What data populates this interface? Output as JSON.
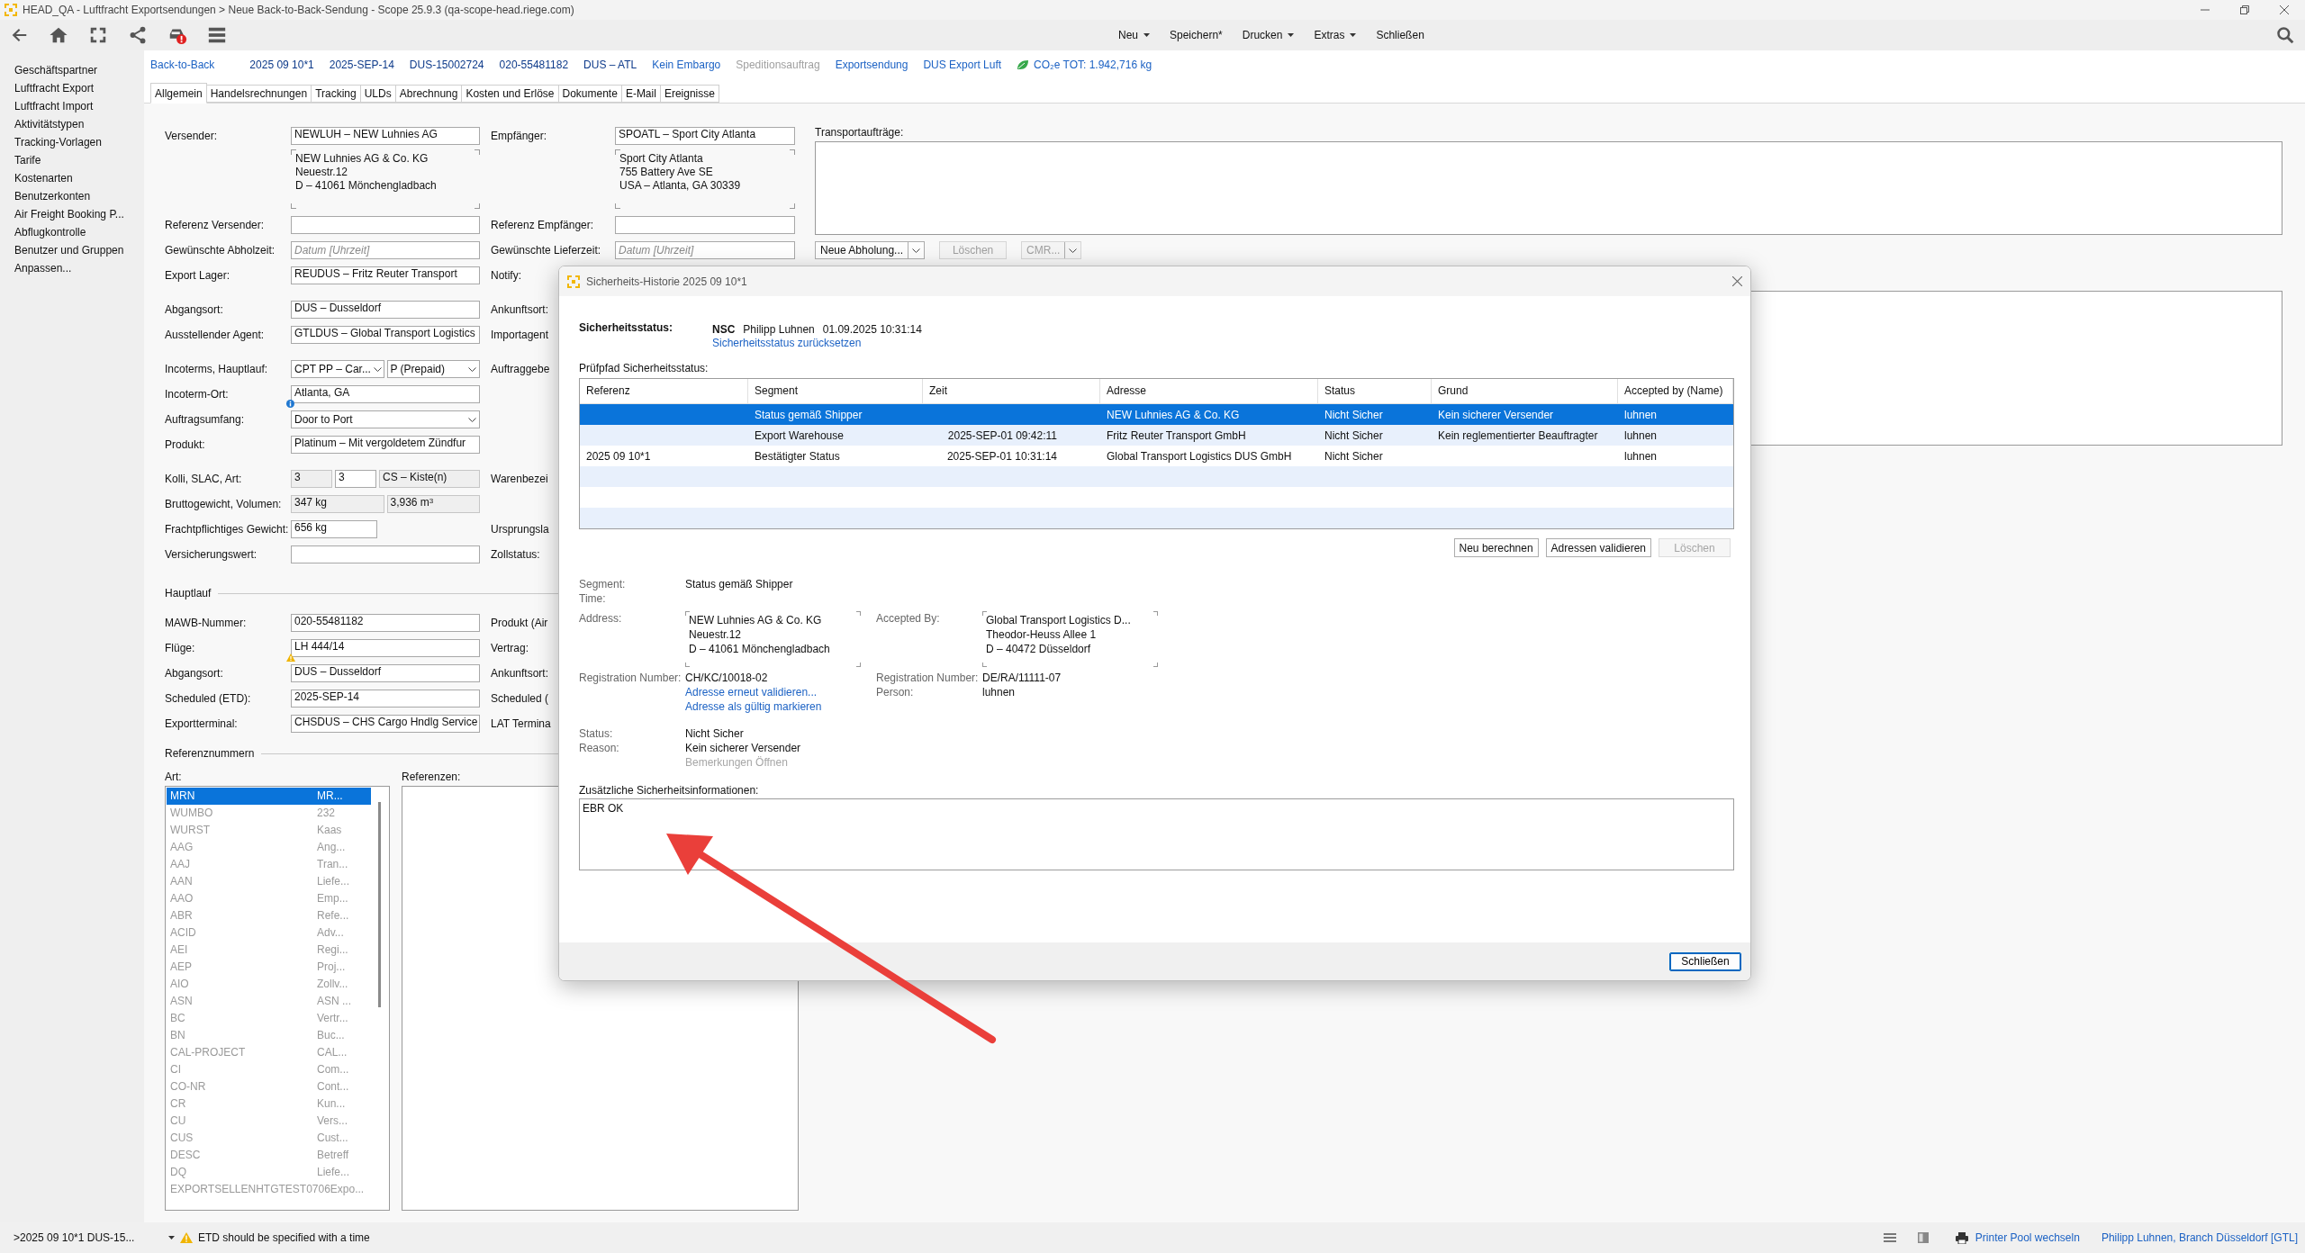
{
  "window": {
    "title": "HEAD_QA - Luftfracht Exportsendungen > Neue Back-to-Back-Sendung - Scope 25.9.3 (qa-scope-head.riege.com)"
  },
  "menu": [
    {
      "label": "Neu",
      "has_menu": true
    },
    {
      "label": "Speichern*",
      "has_menu": false
    },
    {
      "label": "Drucken",
      "has_menu": true
    },
    {
      "label": "Extras",
      "has_menu": true
    },
    {
      "label": "Schließen",
      "has_menu": false
    }
  ],
  "sidebar": {
    "items": [
      "Geschäftspartner",
      "Luftfracht Export",
      "Luftfracht Import",
      "Aktivitätstypen",
      "Tracking-Vorlagen",
      "Tarife",
      "Kostenarten",
      "Benutzerkonten",
      "Air Freight Booking P...",
      "Abflugkontrolle",
      "Benutzer und Gruppen",
      "Anpassen..."
    ]
  },
  "header": [
    {
      "text": "Back-to-Back",
      "kind": "link"
    },
    {
      "text": "2025 09 10*1",
      "kind": "info"
    },
    {
      "text": "2025-SEP-14",
      "kind": "info"
    },
    {
      "text": "DUS-15002724",
      "kind": "info"
    },
    {
      "text": "020-55481182",
      "kind": "info"
    },
    {
      "text": "DUS – ATL",
      "kind": "info"
    },
    {
      "text": "Kein Embargo",
      "kind": "link"
    },
    {
      "text": "Speditionsauftrag",
      "kind": "muted"
    },
    {
      "text": "Exportsendung",
      "kind": "link"
    },
    {
      "text": "DUS Export Luft",
      "kind": "link"
    },
    {
      "text": "CO₂e TOT: 1.942,716 kg",
      "kind": "co2"
    }
  ],
  "tabs": [
    {
      "label": "Allgemein",
      "selected": true
    },
    {
      "label": "Handelsrechnungen",
      "selected": false
    },
    {
      "label": "Tracking",
      "selected": false
    },
    {
      "label": "ULDs",
      "selected": false
    },
    {
      "label": "Abrechnung",
      "selected": false
    },
    {
      "label": "Kosten und Erlöse",
      "selected": false
    },
    {
      "label": "Dokumente",
      "selected": false
    },
    {
      "label": "E-Mail",
      "selected": false
    },
    {
      "label": "Ereignisse",
      "selected": false
    }
  ],
  "form": {
    "blocks": [
      {
        "rows": [
          {
            "left": {
              "label": "Versender:",
              "fields": [
                {
                  "kind": "text",
                  "value": "NEWLUH – NEW Luhnies AG"
                }
              ]
            },
            "right": {
              "label": "Empfänger:",
              "fields": [
                {
                  "kind": "text",
                  "value": "SPOATL – Sport City Atlanta"
                }
              ]
            }
          },
          {
            "left": {
              "fields": [
                {
                  "kind": "address",
                  "lines": [
                    "NEW Luhnies AG & Co. KG",
                    "Neuestr.12",
                    "D – 41061 Mönchengladbach"
                  ]
                }
              ]
            },
            "right": {
              "fields": [
                {
                  "kind": "address",
                  "lines": [
                    "Sport City Atlanta",
                    "755 Battery Ave SE",
                    "USA – Atlanta, GA 30339"
                  ]
                }
              ]
            }
          },
          {
            "left": {
              "label": "Referenz Versender:",
              "fields": [
                {
                  "kind": "text"
                }
              ]
            },
            "right": {
              "label": "Referenz Empfänger:",
              "fields": [
                {
                  "kind": "text"
                }
              ]
            }
          },
          {
            "left": {
              "label": "Gewünschte Abholzeit:",
              "fields": [
                {
                  "kind": "placeholder",
                  "placeholder": "Datum [Uhrzeit]"
                }
              ]
            },
            "right": {
              "label": "Gewünschte Lieferzeit:",
              "fields": [
                {
                  "kind": "placeholder",
                  "placeholder": "Datum [Uhrzeit]"
                }
              ]
            }
          },
          {
            "left": {
              "label": "Export Lager:",
              "fields": [
                {
                  "kind": "text",
                  "value": "REUDUS – Fritz Reuter Transport"
                }
              ]
            },
            "right": {
              "label": "Notify:"
            }
          }
        ]
      },
      {
        "rows": [
          {
            "left": {
              "label": "Abgangsort:",
              "fields": [
                {
                  "kind": "text",
                  "value": "DUS – Dusseldorf"
                }
              ]
            },
            "right": {
              "label": "Ankunftsort:"
            }
          },
          {
            "left": {
              "label": "Ausstellender Agent:",
              "fields": [
                {
                  "kind": "text",
                  "value": "GTLDUS – Global Transport Logistics"
                }
              ]
            },
            "right": {
              "label": "Importagent"
            }
          }
        ]
      },
      {
        "rows": [
          {
            "left": {
              "label": "Incoterms, Hauptlauf:",
              "fields": [
                {
                  "kind": "select",
                  "value": "CPT PP – Car..."
                },
                {
                  "kind": "select",
                  "value": "P (Prepaid)"
                }
              ]
            },
            "right": {
              "label": "Auftraggebe"
            }
          },
          {
            "left": {
              "label": "Incoterm-Ort:",
              "fields": [
                {
                  "kind": "text",
                  "value": "Atlanta, GA",
                  "has_info": true
                }
              ]
            }
          },
          {
            "left": {
              "label": "Auftragsumfang:",
              "fields": [
                {
                  "kind": "select",
                  "value": "Door to Port"
                }
              ]
            }
          },
          {
            "left": {
              "label": "Produkt:",
              "fields": [
                {
                  "kind": "text",
                  "value": "Platinum – Mit vergoldetem Zündfur"
                }
              ]
            }
          }
        ]
      },
      {
        "rows": [
          {
            "left": {
              "label": "Kolli, SLAC, Art:",
              "fields": [
                {
                  "kind": "locked",
                  "value": "3"
                },
                {
                  "kind": "text",
                  "value": "3"
                },
                {
                  "kind": "locked",
                  "value": "CS – Kiste(n)"
                }
              ]
            },
            "right": {
              "label": "Warenbezei"
            }
          },
          {
            "left": {
              "label": "Bruttogewicht, Volumen:",
              "fields": [
                {
                  "kind": "locked",
                  "value": "347 kg"
                },
                {
                  "kind": "locked",
                  "value": "3,936 m$^{3}$"
                }
              ]
            }
          },
          {
            "left": {
              "label": "Frachtpflichtiges Gewicht:",
              "fields": [
                {
                  "kind": "number",
                  "value": "656 kg"
                }
              ]
            },
            "right": {
              "label": "Ursprungsla"
            }
          },
          {
            "left": {
              "label": "Versicherungswert:",
              "fields": [
                {
                  "kind": "text"
                }
              ]
            },
            "right": {
              "label": "Zollstatus:"
            }
          }
        ]
      },
      {
        "section": "Hauptlauf",
        "rows": [
          {
            "left": {
              "label": "MAWB-Nummer:",
              "fields": [
                {
                  "kind": "text",
                  "value": "020-55481182"
                }
              ]
            },
            "right": {
              "label": "Produkt (Air"
            }
          },
          {
            "left": {
              "label": "Flüge:",
              "fields": [
                {
                  "kind": "text",
                  "value": "LH 444/14",
                  "has_warning": true
                }
              ]
            },
            "right": {
              "label": "Vertrag:"
            }
          },
          {
            "left": {
              "label": "Abgangsort:",
              "fields": [
                {
                  "kind": "text",
                  "value": "DUS – Dusseldorf"
                }
              ]
            },
            "right": {
              "label": "Ankunftsort:"
            }
          },
          {
            "left": {
              "label": "Scheduled (ETD):",
              "fields": [
                {
                  "kind": "text",
                  "value": "2025-SEP-14"
                }
              ]
            },
            "right": {
              "label": "Scheduled ("
            }
          },
          {
            "left": {
              "label": "Exportterminal:",
              "fields": [
                {
                  "kind": "text",
                  "value": "CHSDUS – CHS Cargo Hndlg Service"
                }
              ]
            },
            "right": {
              "label": "LAT Termina"
            }
          }
        ]
      }
    ]
  },
  "transport": {
    "label": "Transportaufträge:",
    "buttons": [
      {
        "label": "Neue Abholung...",
        "kind": "split",
        "disabled": false
      },
      {
        "label": "Löschen",
        "kind": "plain",
        "disabled": true
      },
      {
        "label": "CMR...",
        "kind": "split",
        "disabled": true
      }
    ]
  },
  "references": {
    "section": "Referenznummern",
    "types_label": "Art:",
    "refs_label": "Referenzen:",
    "types": [
      {
        "code": "MRN",
        "name": "MR...",
        "selected": true
      },
      {
        "code": "WUMBO",
        "name": "232",
        "selected": false
      },
      {
        "code": "WURST",
        "name": "Kaas",
        "selected": false
      },
      {
        "code": "AAG",
        "name": "Ang...",
        "selected": false
      },
      {
        "code": "AAJ",
        "name": "Tran...",
        "selected": false
      },
      {
        "code": "AAN",
        "name": "Liefe...",
        "selected": false
      },
      {
        "code": "AAO",
        "name": "Emp...",
        "selected": false
      },
      {
        "code": "ABR",
        "name": "Refe...",
        "selected": false
      },
      {
        "code": "ACID",
        "name": "Adv...",
        "selected": false
      },
      {
        "code": "AEI",
        "name": "Regi...",
        "selected": false
      },
      {
        "code": "AEP",
        "name": "Proj...",
        "selected": false
      },
      {
        "code": "AIO",
        "name": "Zollv...",
        "selected": false
      },
      {
        "code": "ASN",
        "name": "ASN ...",
        "selected": false
      },
      {
        "code": "BC",
        "name": "Vertr...",
        "selected": false
      },
      {
        "code": "BN",
        "name": "Buc...",
        "selected": false
      },
      {
        "code": "CAL-PROJECT",
        "name": "CAL...",
        "selected": false
      },
      {
        "code": "CI",
        "name": "Com...",
        "selected": false
      },
      {
        "code": "CO-NR",
        "name": "Cont...",
        "selected": false
      },
      {
        "code": "CR",
        "name": "Kun...",
        "selected": false
      },
      {
        "code": "CU",
        "name": "Vers...",
        "selected": false
      },
      {
        "code": "CUS",
        "name": "Cust...",
        "selected": false
      },
      {
        "code": "DESC",
        "name": "Betreff",
        "selected": false
      },
      {
        "code": "DQ",
        "name": "Liefe...",
        "selected": false
      },
      {
        "code": "EXPORTSELLENHTGTEST0706",
        "name": "Expo...",
        "selected": false
      }
    ]
  },
  "dialog": {
    "title": "Sicherheits-Historie 2025 09 10*1",
    "status_label": "Sicherheitsstatus:",
    "status_code": "NSC",
    "status_user": "Philipp Luhnen",
    "status_time": "01.09.2025 10:31:14",
    "reset_link": "Sicherheitsstatus zurücksetzen",
    "audit_label": "Prüfpfad Sicherheitsstatus:",
    "table": {
      "columns": [
        "Referenz",
        "Segment",
        "Zeit",
        "Adresse",
        "Status",
        "Grund",
        "Accepted by (Name)"
      ],
      "rows": [
        {
          "segment": "Status gemäß Shipper",
          "address": "NEW Luhnies AG & Co. KG",
          "status": "Nicht Sicher",
          "reason": "Kein sicherer Versender",
          "accepted_by": "luhnen",
          "selected": true
        },
        {
          "segment": "Export Warehouse",
          "time": "2025-SEP-01 09:42:11",
          "address": "Fritz Reuter Transport GmbH",
          "status": "Nicht Sicher",
          "reason": "Kein reglementierter Beauftragter",
          "accepted_by": "luhnen",
          "selected": false
        },
        {
          "reference": "2025 09 10*1",
          "segment": "Bestätigter Status",
          "time": "2025-SEP-01 10:31:14",
          "address": "Global Transport Logistics DUS GmbH",
          "status": "Nicht Sicher",
          "accepted_by": "luhnen",
          "selected": false
        }
      ]
    },
    "buttons": [
      {
        "label": "Neu berechnen",
        "disabled": false
      },
      {
        "label": "Adressen validieren",
        "disabled": false
      },
      {
        "label": "Löschen",
        "disabled": true
      }
    ],
    "details": {
      "segment": {
        "label": "Segment:",
        "value": "Status gemäß Shipper"
      },
      "time": {
        "label": "Time:"
      },
      "address": {
        "label": "Address:",
        "lines": [
          "NEW Luhnies AG & Co. KG",
          "Neuestr.12",
          "D – 41061 Mönchengladbach"
        ]
      },
      "registration": {
        "label": "Registration Number:",
        "value": "CH/KC/10018-02"
      },
      "address_links": [
        "Adresse erneut validieren...",
        "Adresse als gültig markieren"
      ],
      "accepted_by": {
        "label": "Accepted By:",
        "lines": [
          "Global Transport Logistics D...",
          "Theodor-Heuss Allee  1",
          "D – 40472 Düsseldorf"
        ]
      },
      "accepted_registration": {
        "label": "Registration Number:",
        "value": "DE/RA/11111-07"
      },
      "person": {
        "label": "Person:",
        "value": "luhnen"
      },
      "status": {
        "label": "Status:",
        "value": "Nicht Sicher"
      },
      "reason": {
        "label": "Reason:",
        "value": "Kein sicherer Versender"
      },
      "remarks_link": {
        "label": "Bemerkungen Öffnen",
        "disabled": true
      }
    },
    "notes_label": "Zusätzliche Sicherheitsinformationen:",
    "notes": "EBR OK",
    "close_button": "Schließen"
  },
  "status_bar": {
    "breadcrumb": ">2025 09 10*1 DUS-15...",
    "message": "ETD should be specified with a time",
    "printer": "Printer Pool wechseln",
    "user": "Philipp Luhnen, Branch Düsseldorf [GTL]"
  }
}
